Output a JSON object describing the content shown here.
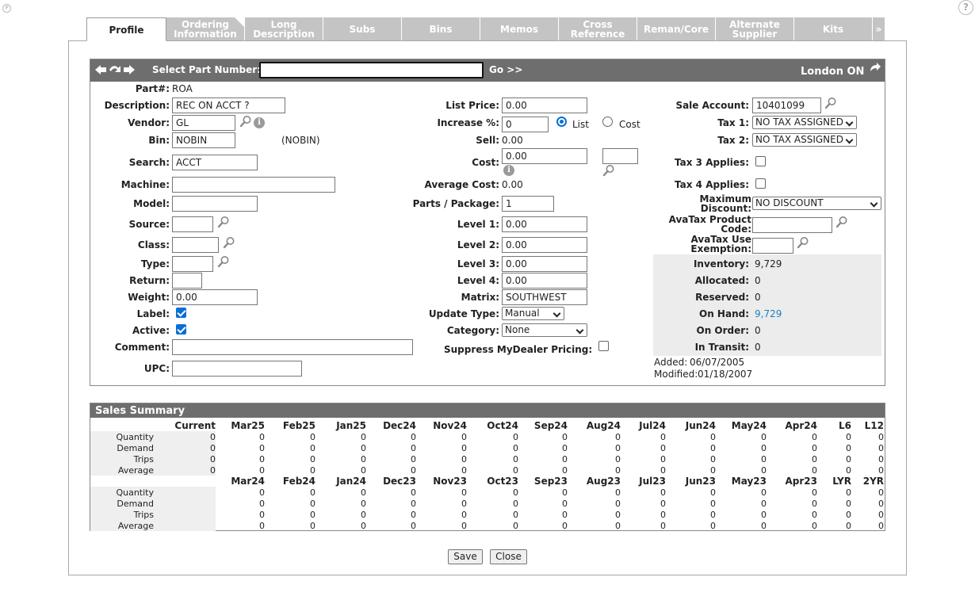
{
  "tabs": [
    {
      "label": "Profile"
    },
    {
      "label": "Ordering Information"
    },
    {
      "label": "Long Description"
    },
    {
      "label": "Subs"
    },
    {
      "label": "Bins"
    },
    {
      "label": "Memos"
    },
    {
      "label": "Cross Reference"
    },
    {
      "label": "Reman/Core"
    },
    {
      "label": "Alternate Supplier"
    },
    {
      "label": "Kits"
    },
    {
      "label": "»"
    }
  ],
  "header": {
    "select_label": "Select Part Number:",
    "part_input_value": "",
    "go_label": "Go >>",
    "location": "London ON"
  },
  "left": {
    "part_label": "Part#:",
    "part_value": "ROA",
    "description_label": "Description:",
    "description_value": "REC ON ACCT  ?",
    "vendor_label": "Vendor:",
    "vendor_value": "GL",
    "bin_label": "Bin:",
    "bin_value": "NOBIN",
    "bin_note": "(NOBIN)",
    "search_label": "Search:",
    "search_value": "ACCT",
    "machine_label": "Machine:",
    "machine_value": "",
    "model_label": "Model:",
    "model_value": "",
    "source_label": "Source:",
    "source_value": "",
    "class_label": "Class:",
    "class_value": "",
    "type_label": "Type:",
    "type_value": "",
    "return_label": "Return:",
    "return_value": "",
    "weight_label": "Weight:",
    "weight_value": "0.00",
    "label_label": "Label:",
    "label_checked": true,
    "active_label": "Active:",
    "active_checked": true,
    "comment_label": "Comment:",
    "comment_value": "",
    "upc_label": "UPC:",
    "upc_value": ""
  },
  "middle": {
    "list_price_label": "List Price:",
    "list_price_value": "0.00",
    "increase_label": "Increase %:",
    "increase_value": "0",
    "list_radio_label": "List",
    "cost_radio_label": "Cost",
    "selected_basis": "List",
    "sell_label": "Sell:",
    "sell_value": "0.00",
    "cost_label": "Cost:",
    "cost_value": "0.00",
    "cost_extra_value": "",
    "avg_cost_label": "Average Cost:",
    "avg_cost_value": "0.00",
    "parts_pkg_label": "Parts / Package:",
    "parts_pkg_value": "1",
    "level1_label": "Level 1:",
    "level1_value": "0.00",
    "level2_label": "Level 2:",
    "level2_value": "0.00",
    "level3_label": "Level 3:",
    "level3_value": "0.00",
    "level4_label": "Level 4:",
    "level4_value": "0.00",
    "matrix_label": "Matrix:",
    "matrix_value": "SOUTHWEST",
    "update_type_label": "Update Type:",
    "update_type_value": "Manual",
    "category_label": "Category:",
    "category_value": "None",
    "suppress_label": "Suppress MyDealer Pricing:",
    "suppress_checked": false
  },
  "right": {
    "sale_account_label": "Sale Account:",
    "sale_account_value": "10401099",
    "tax1_label": "Tax 1:",
    "tax1_value": "NO TAX ASSIGNED",
    "tax2_label": "Tax 2:",
    "tax2_value": "NO TAX ASSIGNED",
    "tax3_label": "Tax 3 Applies:",
    "tax3_checked": false,
    "tax4_label": "Tax 4 Applies:",
    "tax4_checked": false,
    "max_discount_label_1": "Maximum",
    "max_discount_label_2": "Discount:",
    "max_discount_value": "NO DISCOUNT",
    "avatax_code_label_1": "AvaTax Product",
    "avatax_code_label_2": "Code:",
    "avatax_code_value": "",
    "avatax_use_label_1": "AvaTax Use",
    "avatax_use_label_2": "Exemption:",
    "avatax_use_value": "",
    "inventory_label": "Inventory:",
    "inventory_value": "9,729",
    "allocated_label": "Allocated:",
    "allocated_value": "0",
    "reserved_label": "Reserved:",
    "reserved_value": "0",
    "onhand_label": "On Hand:",
    "onhand_value": "9,729",
    "onorder_label": "On Order:",
    "onorder_value": "0",
    "intransit_label": "In Transit:",
    "intransit_value": "0",
    "added_label": "Added:",
    "added_value": "06/07/2005",
    "modified_label": "Modified:",
    "modified_value": "01/18/2007"
  },
  "sales": {
    "title": "Sales Summary",
    "header1": [
      "Current",
      "Mar25",
      "Feb25",
      "Jan25",
      "Dec24",
      "Nov24",
      "Oct24",
      "Sep24",
      "Aug24",
      "Jul24",
      "Jun24",
      "May24",
      "Apr24",
      "L6",
      "L12"
    ],
    "header2": [
      "",
      "Mar24",
      "Feb24",
      "Jan24",
      "Dec23",
      "Nov23",
      "Oct23",
      "Sep23",
      "Aug23",
      "Jul23",
      "Jun23",
      "May23",
      "Apr23",
      "LYR",
      "2YR"
    ],
    "block1": [
      {
        "label": "Quantity",
        "values": [
          "0",
          "0",
          "0",
          "0",
          "0",
          "0",
          "0",
          "0",
          "0",
          "0",
          "0",
          "0",
          "0",
          "0",
          "0"
        ]
      },
      {
        "label": "Demand",
        "values": [
          "0",
          "0",
          "0",
          "0",
          "0",
          "0",
          "0",
          "0",
          "0",
          "0",
          "0",
          "0",
          "0",
          "0",
          "0"
        ]
      },
      {
        "label": "Trips",
        "values": [
          "0",
          "0",
          "0",
          "0",
          "0",
          "0",
          "0",
          "0",
          "0",
          "0",
          "0",
          "0",
          "0",
          "0",
          "0"
        ]
      },
      {
        "label": "Average",
        "values": [
          "0",
          "0",
          "0",
          "0",
          "0",
          "0",
          "0",
          "0",
          "0",
          "0",
          "0",
          "0",
          "0",
          "0",
          "0"
        ]
      }
    ],
    "block2": [
      {
        "label": "Quantity",
        "values": [
          "",
          "0",
          "0",
          "0",
          "0",
          "0",
          "0",
          "0",
          "0",
          "0",
          "0",
          "0",
          "0",
          "0",
          "0"
        ]
      },
      {
        "label": "Demand",
        "values": [
          "",
          "0",
          "0",
          "0",
          "0",
          "0",
          "0",
          "0",
          "0",
          "0",
          "0",
          "0",
          "0",
          "0",
          "0"
        ]
      },
      {
        "label": "Trips",
        "values": [
          "",
          "0",
          "0",
          "0",
          "0",
          "0",
          "0",
          "0",
          "0",
          "0",
          "0",
          "0",
          "0",
          "0",
          "0"
        ]
      },
      {
        "label": "Average",
        "values": [
          "",
          "0",
          "0",
          "0",
          "0",
          "0",
          "0",
          "0",
          "0",
          "0",
          "0",
          "0",
          "0",
          "0",
          "0"
        ]
      }
    ]
  },
  "buttons": {
    "save": "Save",
    "close": "Close"
  },
  "colors": {
    "title_bar": "#6e6e6e",
    "tab_inactive": "#c4c4c4",
    "link": "#1a7fc4",
    "checkbox": "#0a6fd6"
  }
}
